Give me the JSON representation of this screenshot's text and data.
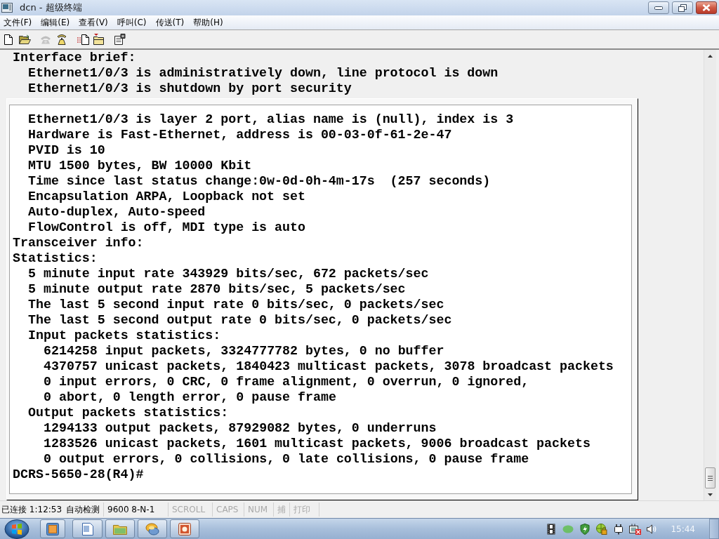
{
  "window": {
    "title": "dcn - 超级终端"
  },
  "menu": [
    "文件(F)",
    "编辑(E)",
    "查看(V)",
    "呼叫(C)",
    "传送(T)",
    "帮助(H)"
  ],
  "toolbar": [
    {
      "buttons": [
        {
          "disabled": false
        },
        {
          "disabled": false
        }
      ]
    },
    {
      "buttons": [
        {
          "disabled": true
        },
        {
          "disabled": false
        }
      ]
    },
    {
      "buttons": [
        {
          "disabled": false
        },
        {
          "disabled": false
        }
      ]
    },
    {
      "buttons": [
        {
          "disabled": false
        }
      ]
    }
  ],
  "terminal": {
    "lines": [
      {
        "text": "Interface brief:",
        "children": [
          {
            "text": "Ethernet1/0/3 is administratively down, line protocol is down"
          },
          {
            "text": "Ethernet1/0/3 is shutdown by port security"
          }
        ]
      }
    ],
    "panel": {
      "lines": [
        {
          "children": [
            {
              "text": "Ethernet1/0/3 is layer 2 port, alias name is (null), index is 3"
            },
            {
              "text": "Hardware is Fast-Ethernet, address is 00-03-0f-61-2e-47"
            },
            {
              "text": "PVID is 10"
            },
            {
              "text": "MTU 1500 bytes, BW 10000 Kbit"
            },
            {
              "text": "Time since last status change:0w-0d-0h-4m-17s  (257 seconds)"
            },
            {
              "text": "Encapsulation ARPA, Loopback not set"
            },
            {
              "text": "Auto-duplex, Auto-speed"
            },
            {
              "text": "FlowControl is off, MDI type is auto"
            }
          ]
        },
        {
          "text": "Transceiver info:"
        },
        {
          "text": "Statistics:",
          "children": [
            {
              "text": "5 minute input rate 343929 bits/sec, 672 packets/sec"
            },
            {
              "text": "5 minute output rate 2870 bits/sec, 5 packets/sec"
            },
            {
              "text": "The last 5 second input rate 0 bits/sec, 0 packets/sec"
            },
            {
              "text": "The last 5 second output rate 0 bits/sec, 0 packets/sec"
            },
            {
              "text": "Input packets statistics:",
              "children": [
                {
                  "text": "6214258 input packets, 3324777782 bytes, 0 no buffer"
                },
                {
                  "text": "4370757 unicast packets, 1840423 multicast packets, 3078 broadcast packets"
                },
                {
                  "text": "0 input errors, 0 CRC, 0 frame alignment, 0 overrun, 0 ignored,"
                },
                {
                  "text": "0 abort, 0 length error, 0 pause frame"
                }
              ]
            },
            {
              "text": "Output packets statistics:",
              "children": [
                {
                  "text": "1294133 output packets, 87929082 bytes, 0 underruns"
                },
                {
                  "text": "1283526 unicast packets, 1601 multicast packets, 9006 broadcast packets"
                },
                {
                  "text": "0 output errors, 0 collisions, 0 late collisions, 0 pause frame"
                }
              ]
            }
          ]
        },
        {
          "text": "DCRS-5650-28(R4)#"
        }
      ]
    }
  },
  "status_bar": {
    "connection": "已连接 1:12:53",
    "detect": "自动检测",
    "settings": "9600 8-N-1",
    "indicators": [
      {
        "label": "SCROLL",
        "on": false
      },
      {
        "label": "CAPS",
        "on": false
      },
      {
        "label": "NUM",
        "on": false
      },
      {
        "label": "捕",
        "on": false
      },
      {
        "label": "打印",
        "on": false
      }
    ]
  },
  "taskbar": {
    "clock": "15:44"
  }
}
